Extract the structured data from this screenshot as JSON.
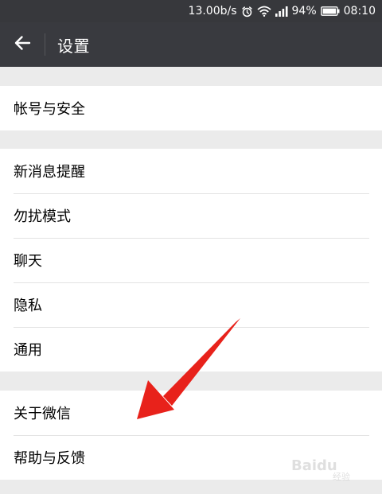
{
  "status_bar": {
    "speed": "13.00b/s",
    "battery_percent": "94%",
    "time": "08:10",
    "icons": [
      "alarm-icon",
      "wifi-icon",
      "signal-icon",
      "battery-icon"
    ]
  },
  "app_bar": {
    "title": "设置",
    "back_icon": "arrow-left-icon"
  },
  "sections": [
    {
      "items": [
        {
          "label": "帐号与安全"
        }
      ]
    },
    {
      "items": [
        {
          "label": "新消息提醒"
        },
        {
          "label": "勿扰模式"
        },
        {
          "label": "聊天"
        },
        {
          "label": "隐私"
        },
        {
          "label": "通用"
        }
      ]
    },
    {
      "items": [
        {
          "label": "关于微信"
        },
        {
          "label": "帮助与反馈"
        }
      ]
    }
  ],
  "annotation": {
    "type": "red-arrow",
    "color": "#e8221b"
  },
  "watermark": {
    "text": "Baidu",
    "sub": "经验"
  },
  "colors": {
    "status_bar": "#37383c",
    "app_bar": "#393a3f",
    "background": "#ebebeb",
    "row": "#ffffff",
    "divider": "#e3e3e3"
  }
}
